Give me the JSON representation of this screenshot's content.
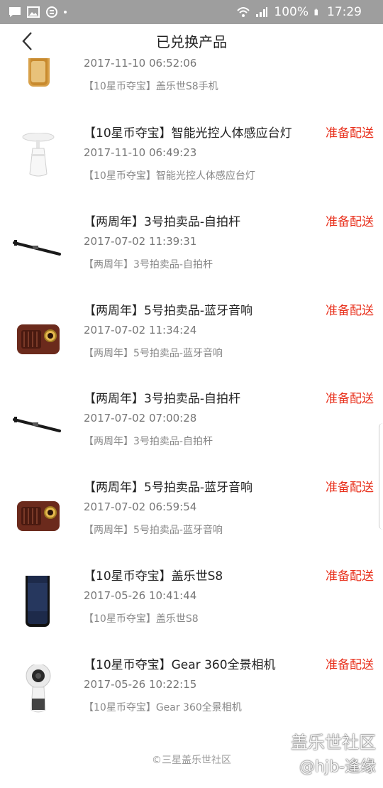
{
  "status_bar": {
    "battery": "100%",
    "time": "17:29"
  },
  "header": {
    "title": "已兑换产品"
  },
  "items": [
    {
      "name": "",
      "status": "",
      "date": "2017-11-10 06:52:06",
      "sub": "【10星币夺宝】盖乐世S8手机",
      "icon": "phone-gold-image"
    },
    {
      "name": "【10星币夺宝】智能光控人体感应台灯",
      "status": "准备配送",
      "date": "2017-11-10 06:49:23",
      "sub": "【10星币夺宝】智能光控人体感应台灯",
      "icon": "lamp-image"
    },
    {
      "name": "【两周年】3号拍卖品-自拍杆",
      "status": "准备配送",
      "date": "2017-07-02 11:39:31",
      "sub": "【两周年】3号拍卖品-自拍杆",
      "icon": "selfie-stick-image"
    },
    {
      "name": "【两周年】5号拍卖品-蓝牙音响",
      "status": "准备配送",
      "date": "2017-07-02 11:34:24",
      "sub": "【两周年】5号拍卖品-蓝牙音响",
      "icon": "speaker-image"
    },
    {
      "name": "【两周年】3号拍卖品-自拍杆",
      "status": "准备配送",
      "date": "2017-07-02 07:00:28",
      "sub": "【两周年】3号拍卖品-自拍杆",
      "icon": "selfie-stick-image"
    },
    {
      "name": "【两周年】5号拍卖品-蓝牙音响",
      "status": "准备配送",
      "date": "2017-07-02 06:59:54",
      "sub": "【两周年】5号拍卖品-蓝牙音响",
      "icon": "speaker-image"
    },
    {
      "name": "【10星币夺宝】盖乐世S8",
      "status": "准备配送",
      "date": "2017-05-26 10:41:44",
      "sub": "【10星币夺宝】盖乐世S8",
      "icon": "phone-black-image"
    },
    {
      "name": "【10星币夺宝】Gear 360全景相机",
      "status": "准备配送",
      "date": "2017-05-26 10:22:15",
      "sub": "【10星币夺宝】Gear 360全景相机",
      "icon": "gear360-image"
    }
  ],
  "footer": {
    "text": "©三星盖乐世社区"
  },
  "watermark": {
    "line1": "盖乐世社区",
    "line2": "@hjb-逢缘"
  },
  "colors": {
    "status_bar": "#9e9e9e",
    "status_red": "#e8301c"
  }
}
